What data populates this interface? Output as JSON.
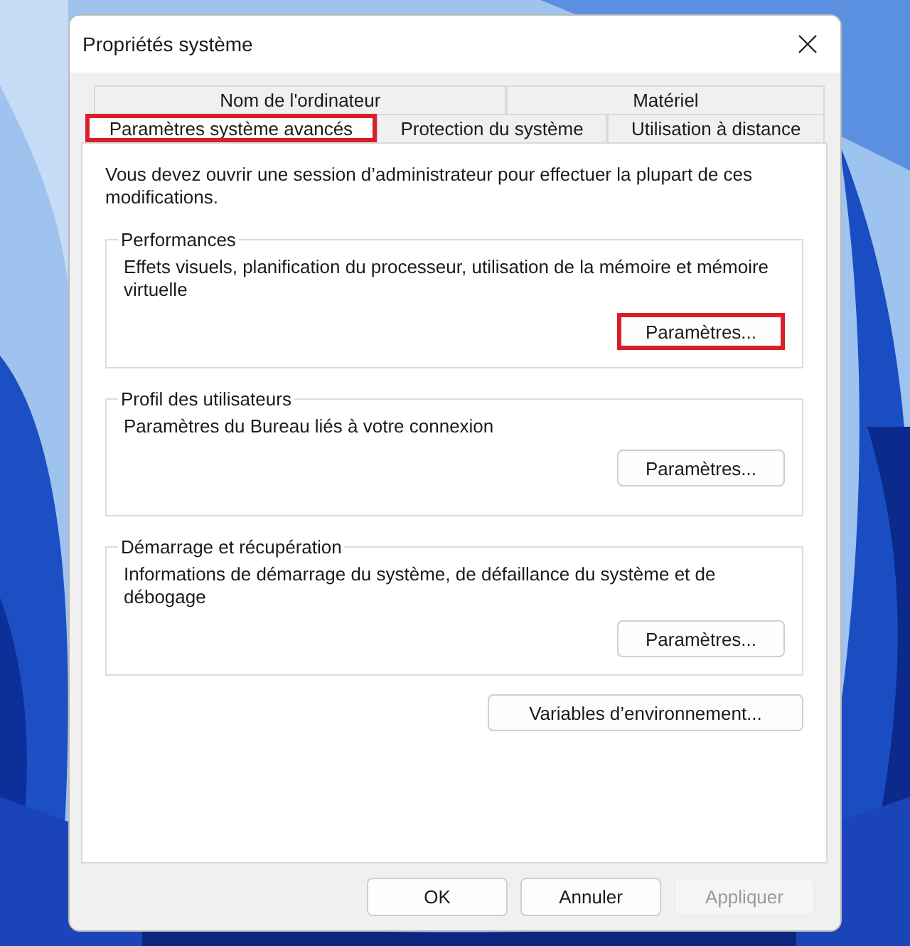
{
  "window": {
    "title": "Propriétés système"
  },
  "tab_rows": [
    [
      {
        "label": "Nom de l'ordinateur",
        "selected": false,
        "highlighted": false
      },
      {
        "label": "Matériel",
        "selected": false,
        "highlighted": false
      }
    ],
    [
      {
        "label": "Paramètres système avancés",
        "selected": true,
        "highlighted": true
      },
      {
        "label": "Protection du système",
        "selected": false,
        "highlighted": false
      },
      {
        "label": "Utilisation à distance",
        "selected": false,
        "highlighted": false
      }
    ]
  ],
  "notice": "Vous devez ouvrir une session d’administrateur pour effectuer la plupart de ces modifications.",
  "groups": [
    {
      "title": "Performances",
      "description": "Effets visuels, planification du processeur, utilisation de la mémoire et mémoire virtuelle",
      "button": {
        "label": "Paramètres...",
        "highlighted": true
      }
    },
    {
      "title": "Profil des utilisateurs",
      "description": "Paramètres du Bureau liés à votre connexion",
      "button": {
        "label": "Paramètres...",
        "highlighted": false
      }
    },
    {
      "title": "Démarrage et récupération",
      "description": "Informations de démarrage du système, de défaillance du système et de débogage",
      "button": {
        "label": "Paramètres...",
        "highlighted": false
      }
    }
  ],
  "env_button": "Variables d’environnement...",
  "buttons": [
    {
      "label": "OK",
      "disabled": false
    },
    {
      "label": "Annuler",
      "disabled": false
    },
    {
      "label": "Appliquer",
      "disabled": true
    }
  ]
}
